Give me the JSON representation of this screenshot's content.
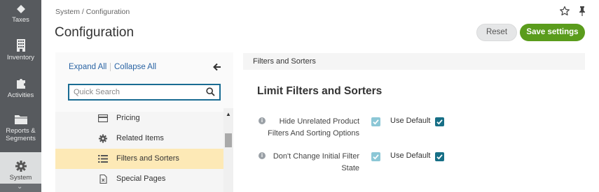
{
  "nav": {
    "items": [
      {
        "label": "Taxes",
        "icon": "taxes-icon"
      },
      {
        "label": "Inventory",
        "icon": "inventory-icon"
      },
      {
        "label": "Activities",
        "icon": "puzzle-icon"
      },
      {
        "label": "Reports &",
        "label2": "Segments",
        "icon": "folder-icon"
      },
      {
        "label": "System",
        "icon": "gear-icon"
      }
    ]
  },
  "header": {
    "breadcrumb": "System / Configuration",
    "title": "Configuration",
    "reset_label": "Reset",
    "save_label": "Save settings"
  },
  "tree": {
    "expand_all": "Expand All",
    "collapse_all": "Collapse All",
    "search_placeholder": "Quick Search",
    "items": [
      {
        "label": "Pricing",
        "icon": "card-icon",
        "selected": false
      },
      {
        "label": "Related Items",
        "icon": "gear-icon",
        "selected": false
      },
      {
        "label": "Filters and Sorters",
        "icon": "list-icon",
        "selected": true
      },
      {
        "label": "Special Pages",
        "icon": "document-icon",
        "selected": false
      }
    ]
  },
  "content": {
    "section_bar": "Filters and Sorters",
    "section_title": "Limit Filters and Sorters",
    "fields": [
      {
        "label": "Hide Unrelated Product Filters And Sorting Options",
        "checked": true,
        "use_default_label": "Use Default",
        "use_default": true
      },
      {
        "label": "Don't Change Initial Filter State",
        "checked": true,
        "use_default_label": "Use Default",
        "use_default": true
      }
    ]
  },
  "colors": {
    "nav_bg": "#575a5e",
    "save_button": "#5a9c1c",
    "link": "#2a64a4",
    "selected_row": "#fde9b6",
    "checkbox_default": "#176f86",
    "checkbox_main": "#8cc7d6"
  }
}
